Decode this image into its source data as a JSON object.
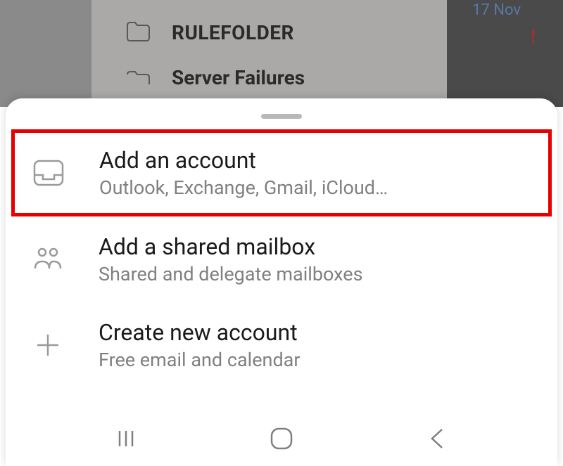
{
  "background": {
    "date": "17 Nov",
    "folders": [
      {
        "label": "RULEFOLDER"
      },
      {
        "label": "Server Failures"
      }
    ]
  },
  "sheet": {
    "items": [
      {
        "icon": "inbox-icon",
        "title": "Add an account",
        "subtitle": "Outlook, Exchange, Gmail, iCloud…",
        "highlighted": true
      },
      {
        "icon": "people-icon",
        "title": "Add a shared mailbox",
        "subtitle": "Shared and delegate mailboxes",
        "highlighted": false
      },
      {
        "icon": "plus-icon",
        "title": "Create new account",
        "subtitle": "Free email and calendar",
        "highlighted": false
      }
    ]
  }
}
